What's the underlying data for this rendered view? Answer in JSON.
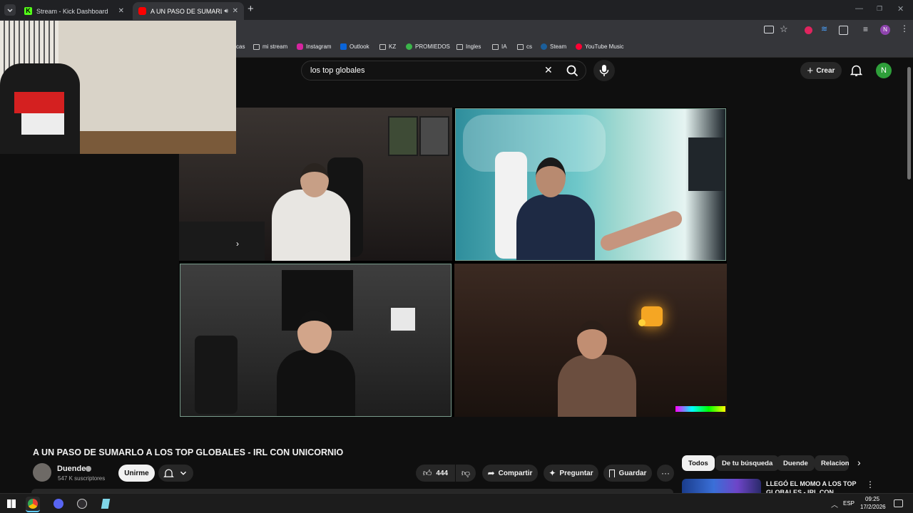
{
  "browser": {
    "tabs": [
      {
        "title": "Stream - Kick Dashboard",
        "favicon_color": "#53fc18"
      },
      {
        "title": "A UN PASO DE SUMARLO A",
        "favicon_color": "#ff0000"
      }
    ],
    "new_tab_symbol": "+",
    "profile_initial": "N",
    "bookmarks": [
      {
        "label": "cas",
        "icon": "folder-icon"
      },
      {
        "label": "mi stream",
        "icon": "folder-icon"
      },
      {
        "label": "Instagram",
        "icon": "instagram-icon"
      },
      {
        "label": "Outlook",
        "icon": "outlook-icon"
      },
      {
        "label": "KZ",
        "icon": "folder-icon"
      },
      {
        "label": "PROMIEDOS",
        "icon": "promiedos-icon"
      },
      {
        "label": "Ingles",
        "icon": "folder-icon"
      },
      {
        "label": "IA",
        "icon": "folder-icon"
      },
      {
        "label": "cs",
        "icon": "folder-icon"
      },
      {
        "label": "Steam",
        "icon": "steam-icon"
      },
      {
        "label": "YouTube Music",
        "icon": "youtube-music-icon"
      }
    ]
  },
  "youtube": {
    "search": {
      "query": "los top globales"
    },
    "create_label": "Crear",
    "avatar_initial": "N",
    "video": {
      "title": "A UN PASO DE SUMARLO A LOS TOP GLOBALES - IRL CON UNICORNIO",
      "channel": "Duende",
      "subscribers": "547 K suscriptores",
      "join_label": "Unirme",
      "likes": "444",
      "share_label": "Compartir",
      "ask_label": "Preguntar",
      "save_label": "Guardar"
    },
    "chips": [
      "Todos",
      "De tu búsqueda",
      "Duende",
      "Relacion"
    ],
    "recommendation": {
      "title_line1": "LLEGÓ EL MOMO A LOS TOP",
      "title_line2": "GLOBALES - IRL CON"
    }
  },
  "taskbar": {
    "language": "ESP",
    "time": "09:25",
    "date": "17/2/2026"
  },
  "colors": {
    "kick_green": "#53fc18",
    "youtube_red": "#ff0000",
    "avatar_green": "#2e9f3a",
    "profile_purple": "#8e44ad"
  }
}
